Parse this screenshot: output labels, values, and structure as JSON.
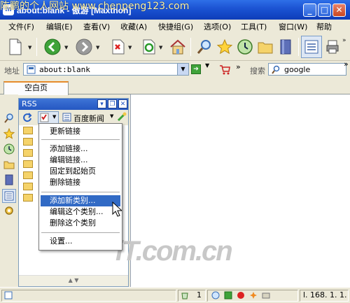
{
  "window": {
    "title": "about:blank - 傲游 [Maxthon]",
    "watermark": "陈鹏的个人网站 www.chenpeng123.com",
    "app_icon_text": "m"
  },
  "menu": [
    "文件(F)",
    "编辑(E)",
    "查看(V)",
    "收藏(A)",
    "快捷组(G)",
    "选项(O)",
    "工具(T)",
    "窗口(W)",
    "帮助"
  ],
  "address": {
    "label": "地址",
    "value": "about:blank",
    "search_label": "搜索",
    "search_value": "google"
  },
  "tabs": [
    {
      "label": "空白页"
    }
  ],
  "sidebar_panel": {
    "title": "RSS",
    "feed_selector": "百度新闻",
    "folder_count": 7
  },
  "context_menu": {
    "items": [
      "更新链接",
      "添加链接...",
      "编辑链接...",
      "固定到起始页",
      "删除链接",
      "添加新类别...",
      "编辑这个类别...",
      "删除这个类别",
      "设置..."
    ],
    "highlighted": "添加新类别..."
  },
  "content": {
    "logo_text": "iT.com.cn"
  },
  "status": {
    "count": "1",
    "ip_text": "l. 168. 1. 1."
  },
  "icons": [
    "new-page-icon",
    "back-icon",
    "forward-icon",
    "stop-icon",
    "refresh-icon",
    "home-icon",
    "search-icon",
    "favorites-star-icon",
    "history-icon",
    "folder-icon",
    "book-icon",
    "sidebar-list-icon",
    "print-icon",
    "go-icon",
    "shop-icon"
  ]
}
